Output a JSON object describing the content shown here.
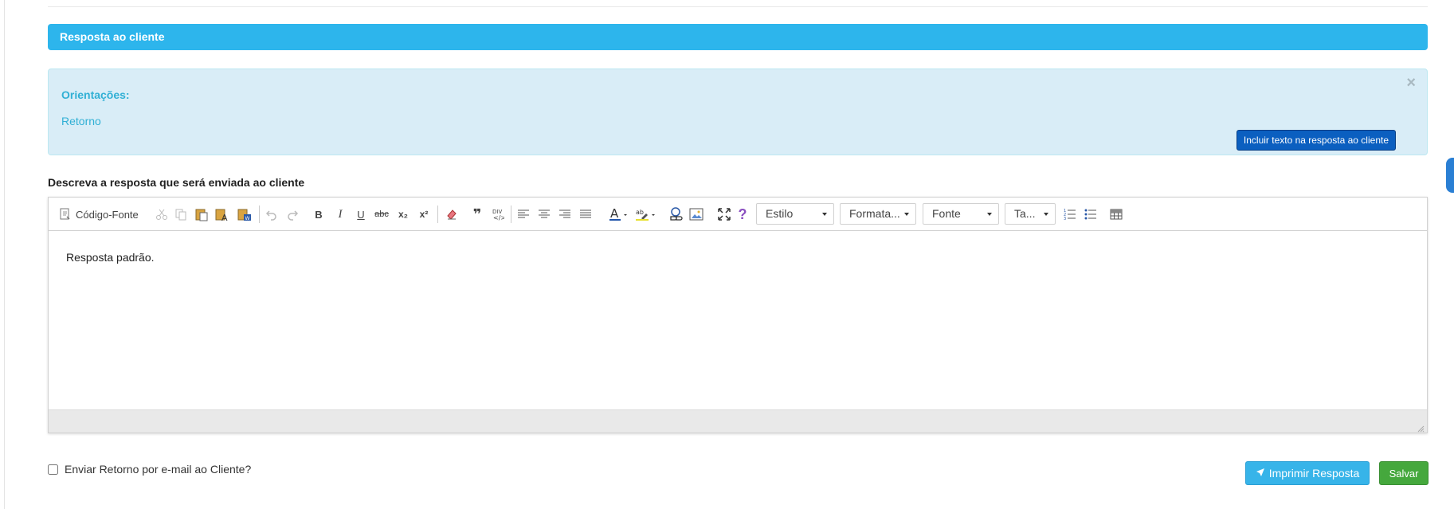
{
  "section": {
    "title": "Resposta ao cliente"
  },
  "guidance": {
    "title": "Orientações:",
    "text": "Retorno",
    "close_symbol": "×",
    "include_button": "Incluir texto na resposta ao cliente"
  },
  "editor": {
    "label": "Descreva a resposta que será enviada ao cliente",
    "toolbar": {
      "source_label": "Código-Fonte",
      "combos": {
        "style": "Estilo",
        "format": "Formata...",
        "font": "Fonte",
        "size": "Ta..."
      },
      "buttons": {
        "bold": "B",
        "italic": "I",
        "underline": "U",
        "strike": "abc",
        "subscript": "x₂",
        "superscript": "x²",
        "blockquote": "❞",
        "help": "?"
      }
    },
    "content": "Resposta padrão."
  },
  "footer": {
    "email_checkbox_label": "Enviar Retorno por e-mail ao Cliente?",
    "print_button": "Imprimir Resposta",
    "save_button": "Salvar"
  },
  "colors": {
    "header_blue": "#2db5ec",
    "info_bg": "#d9edf7",
    "info_text": "#31b0d5",
    "primary_dark": "#0b5fc0",
    "success": "#45a83d"
  },
  "icons": [
    "source-icon",
    "cut-icon",
    "copy-icon",
    "paste-icon",
    "paste-text-icon",
    "paste-word-icon",
    "undo-icon",
    "redo-icon",
    "remove-format-icon",
    "blockquote-icon",
    "div-icon",
    "align-left-icon",
    "align-center-icon",
    "align-right-icon",
    "justify-icon",
    "text-color-icon",
    "background-color-icon",
    "link-icon",
    "image-icon",
    "maximize-icon",
    "help-icon",
    "numbered-list-icon",
    "bulleted-list-icon",
    "table-icon",
    "rocket-icon",
    "close-icon"
  ]
}
